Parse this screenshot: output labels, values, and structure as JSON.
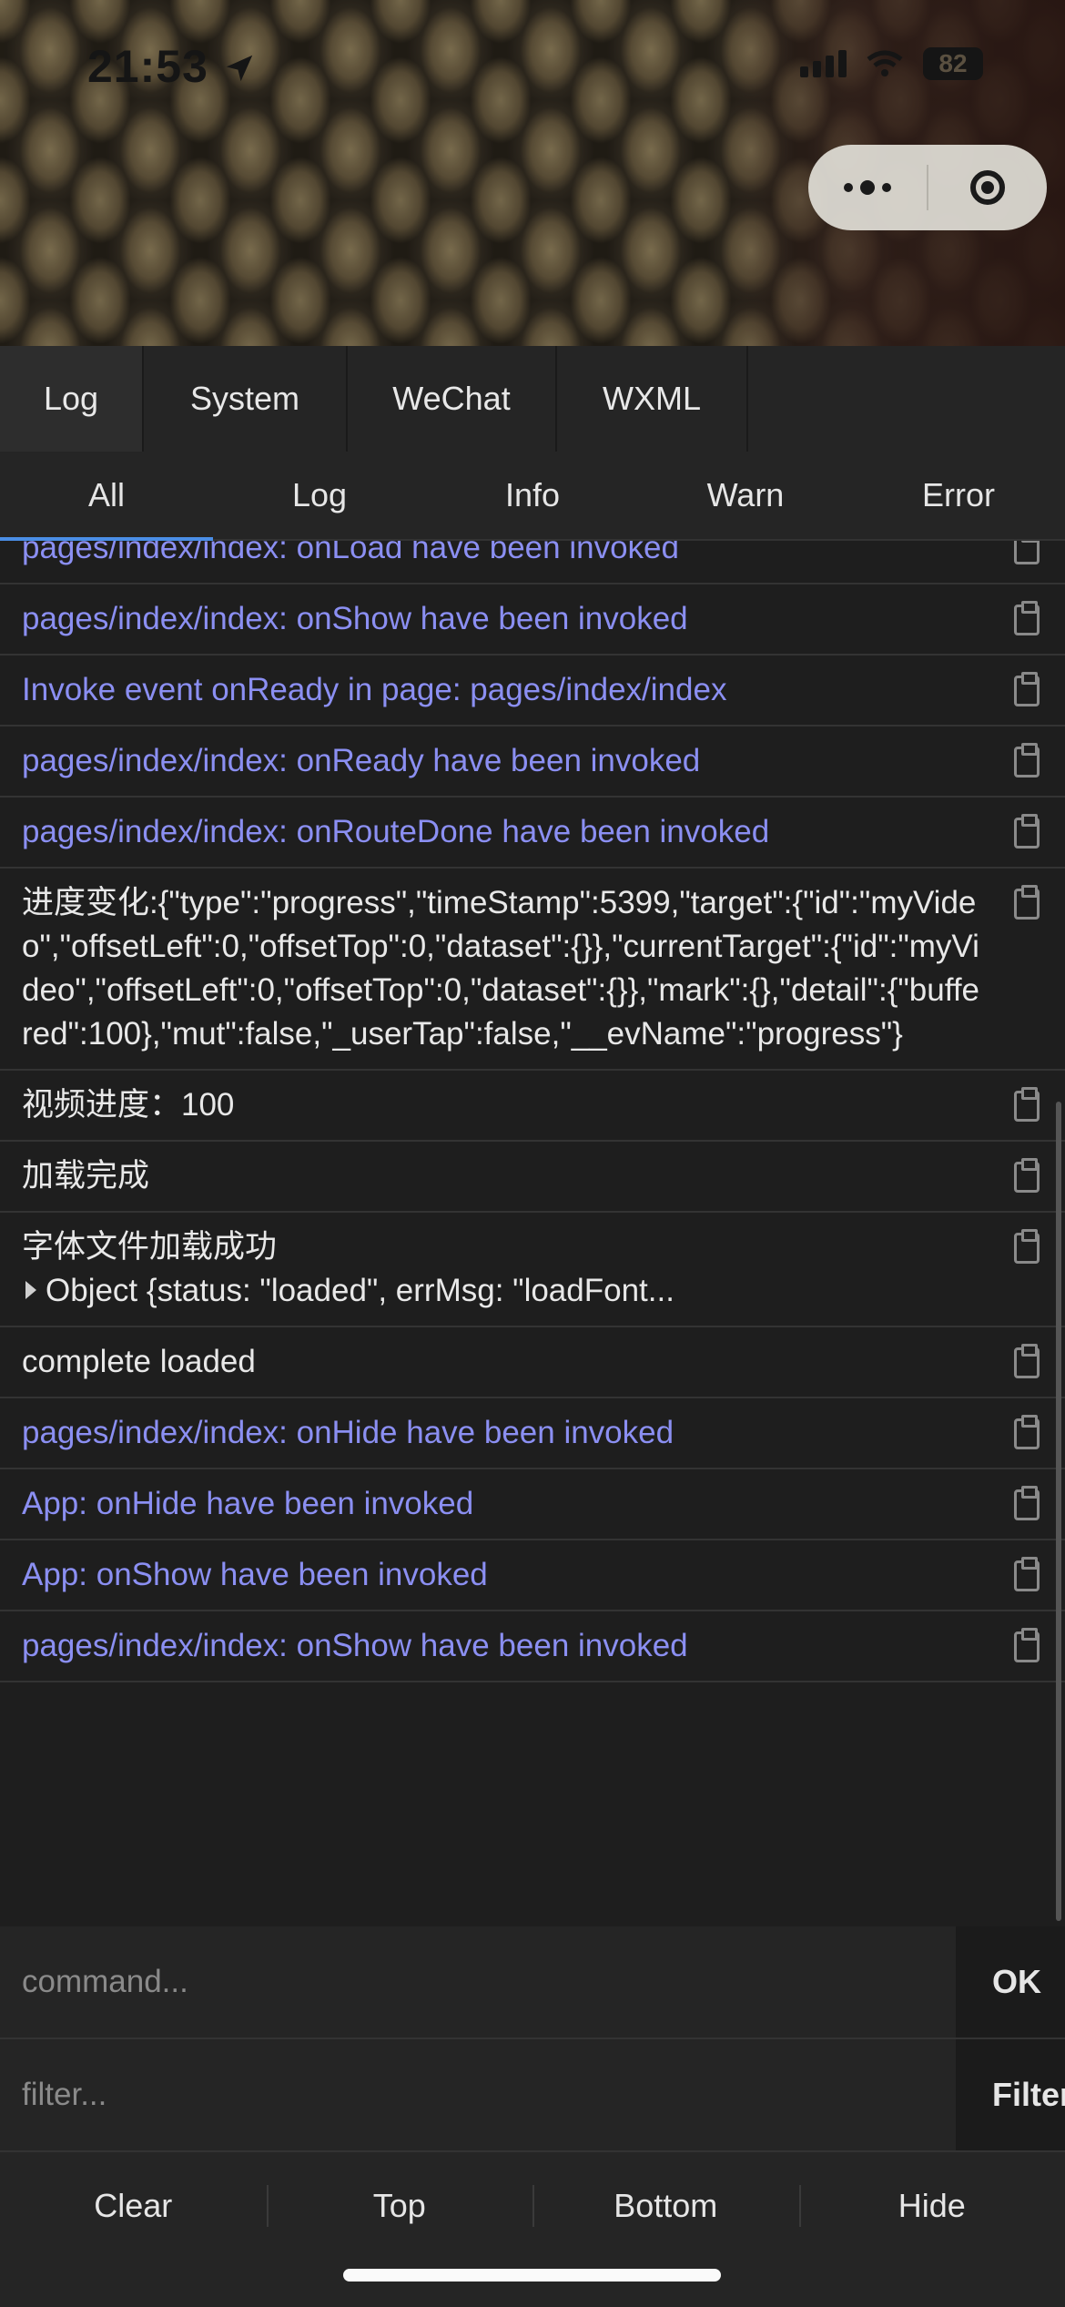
{
  "status_bar": {
    "time": "21:53",
    "battery": "82"
  },
  "tabs": [
    "Log",
    "System",
    "WeChat",
    "WXML"
  ],
  "subtabs": [
    "All",
    "Log",
    "Info",
    "Warn",
    "Error"
  ],
  "logs": [
    "pages/index/index: onLoad have been invoked",
    "pages/index/index: onShow have been invoked",
    "Invoke event onReady in page: pages/index/index",
    "pages/index/index: onReady have been invoked",
    "pages/index/index: onRouteDone have been invoked",
    "进度变化:{\"type\":\"progress\",\"timeStamp\":5399,\"target\":{\"id\":\"myVideo\",\"offsetLeft\":0,\"offsetTop\":0,\"dataset\":{}},\"currentTarget\":{\"id\":\"myVideo\",\"offsetLeft\":0,\"offsetTop\":0,\"dataset\":{}},\"mark\":{},\"detail\":{\"buffered\":100},\"mut\":false,\"_userTap\":false,\"__evName\":\"progress\"}",
    "视频进度：100",
    "加载完成",
    "字体文件加载成功",
    "Object {status: \"loaded\", errMsg: \"loadFont...",
    "complete loaded",
    "pages/index/index: onHide have been invoked",
    "App: onHide have been invoked",
    "App: onShow have been invoked",
    "pages/index/index: onShow have been invoked"
  ],
  "command": {
    "placeholder": "command...",
    "button": "OK"
  },
  "filter": {
    "placeholder": "filter...",
    "button": "Filter"
  },
  "footer": [
    "Clear",
    "Top",
    "Bottom",
    "Hide"
  ]
}
